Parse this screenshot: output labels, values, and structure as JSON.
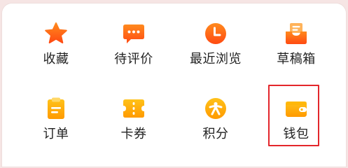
{
  "menu": {
    "items": [
      {
        "label": "收藏",
        "icon": "star-icon"
      },
      {
        "label": "待评价",
        "icon": "comment-icon"
      },
      {
        "label": "最近浏览",
        "icon": "clock-icon"
      },
      {
        "label": "草稿箱",
        "icon": "draft-box-icon"
      },
      {
        "label": "订单",
        "icon": "order-clipboard-icon"
      },
      {
        "label": "卡券",
        "icon": "ticket-icon"
      },
      {
        "label": "积分",
        "icon": "points-medal-icon"
      },
      {
        "label": "钱包",
        "icon": "wallet-icon"
      }
    ],
    "selected_label": "钱包"
  },
  "colors": {
    "icon_gradient_start": "#ffb11a",
    "icon_gradient_end": "#ff5a1f",
    "highlight_border": "#e3262b",
    "text": "#222222",
    "page_background": "#f6e5e4"
  }
}
